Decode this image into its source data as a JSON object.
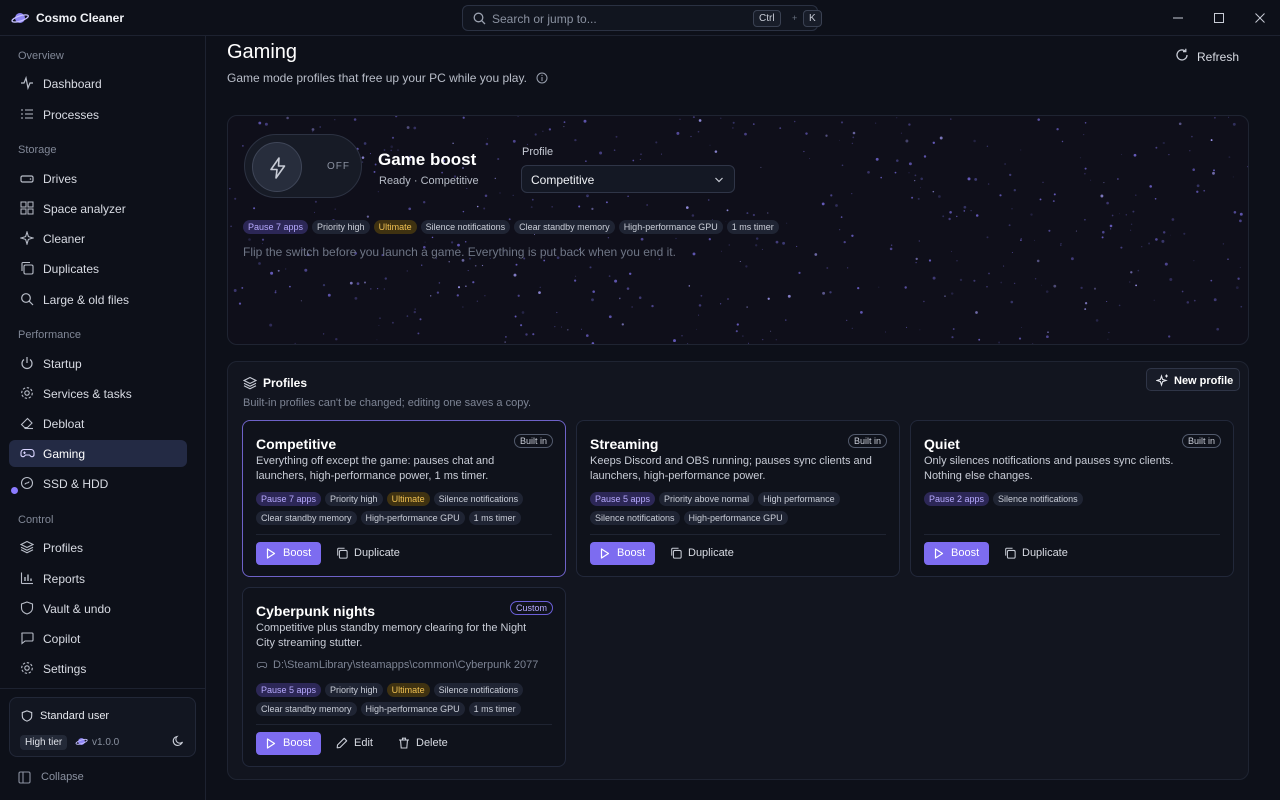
{
  "app": {
    "title": "Cosmo Cleaner"
  },
  "search": {
    "placeholder": "Search or jump to...",
    "key1": "Ctrl",
    "plus": "+",
    "key2": "K"
  },
  "sidebar": {
    "sections": [
      "Overview",
      "Storage",
      "Performance",
      "Control"
    ],
    "items": [
      {
        "label": "Dashboard",
        "icon": "activity-icon"
      },
      {
        "label": "Processes",
        "icon": "list-icon"
      },
      {
        "label": "Drives",
        "icon": "drive-icon"
      },
      {
        "label": "Space analyzer",
        "icon": "grid-icon"
      },
      {
        "label": "Cleaner",
        "icon": "sparkle-icon"
      },
      {
        "label": "Duplicates",
        "icon": "copy-icon"
      },
      {
        "label": "Large & old files",
        "icon": "search-icon"
      },
      {
        "label": "Startup",
        "icon": "power-icon"
      },
      {
        "label": "Services & tasks",
        "icon": "gear-icon"
      },
      {
        "label": "Debloat",
        "icon": "eraser-icon"
      },
      {
        "label": "Gaming",
        "icon": "gamepad-icon"
      },
      {
        "label": "SSD & HDD",
        "icon": "ssd-icon"
      },
      {
        "label": "Profiles",
        "icon": "layers-icon"
      },
      {
        "label": "Reports",
        "icon": "chart-icon"
      },
      {
        "label": "Vault & undo",
        "icon": "shield-icon"
      },
      {
        "label": "Copilot",
        "icon": "chat-icon"
      },
      {
        "label": "Settings",
        "icon": "gear-icon"
      }
    ],
    "user": {
      "label": "Standard user",
      "tier": "High tier",
      "version": "v1.0.0"
    },
    "collapse": "Collapse"
  },
  "page": {
    "title": "Gaming",
    "subtitle": "Game mode profiles that free up your PC while you play.",
    "refresh": "Refresh"
  },
  "boost": {
    "state": "OFF",
    "title": "Game boost",
    "status": "Ready · Competitive",
    "profile_label": "Profile",
    "profile_value": "Competitive",
    "chips": [
      "Pause 7 apps",
      "Priority high",
      "Ultimate",
      "Silence notifications",
      "Clear standby memory",
      "High-performance GPU",
      "1 ms timer"
    ],
    "note": "Flip the switch before you launch a game. Everything is put back when you end it."
  },
  "profiles": {
    "title": "Profiles",
    "subtitle": "Built-in profiles can't be changed; editing one saves a copy.",
    "new": "New profile",
    "cards": [
      {
        "name": "Competitive",
        "badge": "Built in",
        "desc": "Everything off except the game: pauses chat and launchers, high-performance power, 1 ms timer.",
        "chips1": [
          "Pause 7 apps",
          "Priority high",
          "Ultimate",
          "Silence notifications"
        ],
        "chips2": [
          "Clear standby memory",
          "High-performance GPU",
          "1 ms timer"
        ],
        "boost": "Boost",
        "action": "Duplicate"
      },
      {
        "name": "Streaming",
        "badge": "Built in",
        "desc": "Keeps Discord and OBS running; pauses sync clients and launchers, high-performance power.",
        "chips1": [
          "Pause 5 apps",
          "Priority above normal",
          "High performance"
        ],
        "chips2": [
          "Silence notifications",
          "High-performance GPU"
        ],
        "boost": "Boost",
        "action": "Duplicate"
      },
      {
        "name": "Quiet",
        "badge": "Built in",
        "desc": "Only silences notifications and pauses sync clients. Nothing else changes.",
        "chips1": [
          "Pause 2 apps",
          "Silence notifications"
        ],
        "boost": "Boost",
        "action": "Duplicate"
      },
      {
        "name": "Cyberpunk nights",
        "badge": "Custom",
        "desc": "Competitive plus standby memory clearing for the Night City streaming stutter.",
        "path": "D:\\SteamLibrary\\steamapps\\common\\Cyberpunk 2077",
        "chips1": [
          "Pause 5 apps",
          "Priority high",
          "Ultimate",
          "Silence notifications"
        ],
        "chips2": [
          "Clear standby memory",
          "High-performance GPU",
          "1 ms timer"
        ],
        "boost": "Boost",
        "edit": "Edit",
        "delete": "Delete"
      }
    ]
  },
  "colors": {
    "accent": "#7d6cf0",
    "background": "#0d1019",
    "ultimate": "#f0c152"
  }
}
